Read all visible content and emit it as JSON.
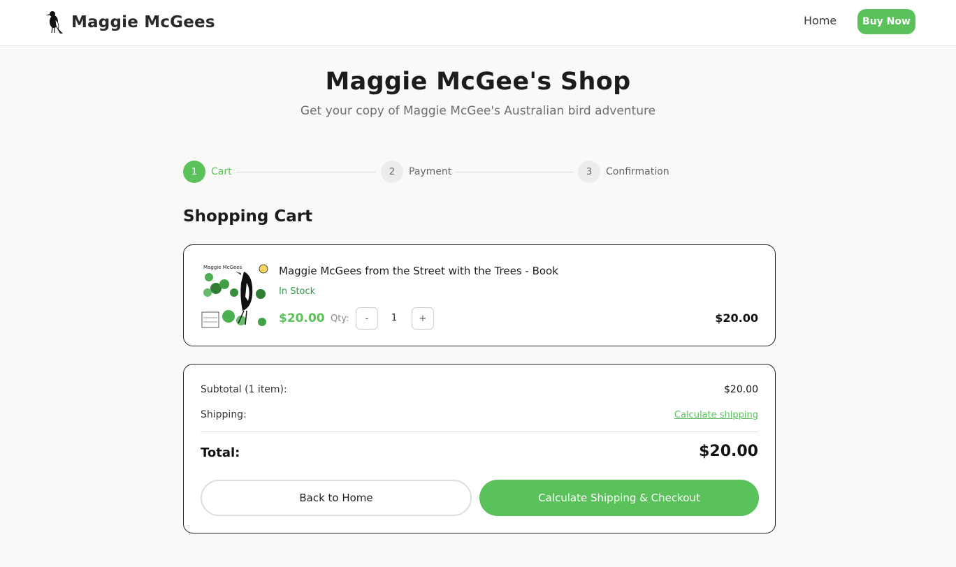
{
  "header": {
    "brand_name": "Maggie McGees",
    "logo_icon": "magpie-logo-icon",
    "nav_home": "Home",
    "nav_buy": "Buy Now"
  },
  "hero": {
    "title": "Maggie McGee's Shop",
    "subtitle": "Get your copy of Maggie McGee's Australian bird adventure"
  },
  "stepper": {
    "steps": [
      {
        "number": "1",
        "label": "Cart",
        "state": "active"
      },
      {
        "number": "2",
        "label": "Payment",
        "state": "inactive"
      },
      {
        "number": "3",
        "label": "Confirmation",
        "state": "inactive"
      }
    ]
  },
  "cart": {
    "title": "Shopping Cart",
    "item": {
      "name": "Maggie McGees from the Street with the Trees - Book",
      "stock": "In Stock",
      "price": "$20.00",
      "qty_label": "Qty:",
      "qty_minus": "-",
      "qty_value": "1",
      "qty_plus": "+",
      "line_total": "$20.00",
      "thumbnail_icon": "book-cover-thumbnail"
    }
  },
  "summary": {
    "subtotal_label": "Subtotal (1 item):",
    "subtotal_value": "$20.00",
    "shipping_label": "Shipping:",
    "shipping_link": "Calculate shipping",
    "total_label": "Total:",
    "total_value": "$20.00",
    "back_button": "Back to Home",
    "checkout_button": "Calculate Shipping & Checkout"
  },
  "colors": {
    "accent": "#5bc15b",
    "stock_green": "#2e9a4a",
    "background": "#f9f9f7"
  }
}
